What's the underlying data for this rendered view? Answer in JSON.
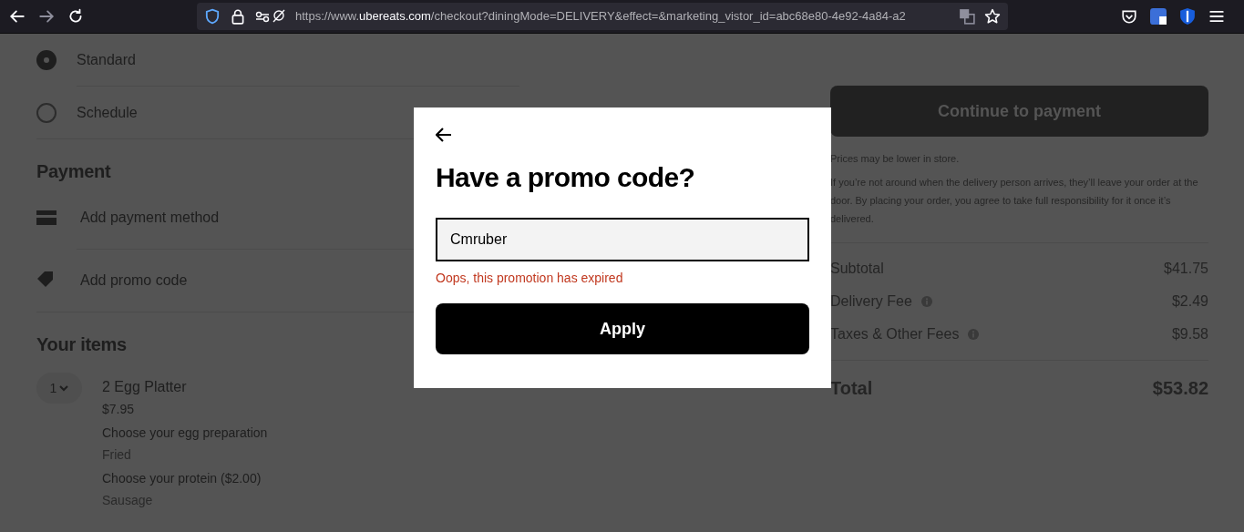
{
  "browser": {
    "url": {
      "prefix": "https://www.",
      "domain": "ubereats.com",
      "path": "/checkout?diningMode=DELIVERY&effect=&marketing_vistor_id=abc68e80-4e92-4a84-a2"
    }
  },
  "delivery_options": [
    {
      "label": "Standard",
      "selected": true
    },
    {
      "label": "Schedule",
      "selected": false
    }
  ],
  "payment": {
    "heading": "Payment",
    "rows": [
      {
        "kind": "card",
        "label": "Add payment method"
      },
      {
        "kind": "tag",
        "label": "Add promo code"
      }
    ]
  },
  "items": {
    "heading": "Your items",
    "list": [
      {
        "quantity": "1",
        "name": "2 Egg Platter",
        "price": "$7.95",
        "options": [
          {
            "question": "Choose your egg preparation",
            "answer": "Fried"
          },
          {
            "question": "Choose your protein ($2.00)",
            "answer": "Sausage"
          }
        ]
      }
    ]
  },
  "summary": {
    "button": "Continue to payment",
    "note": "Prices may be lower in store.",
    "disclaimer": "If you’re not around when the delivery person arrives, they’ll leave your order at the door. By placing your order, you agree to take full responsibility for it once it’s delivered.",
    "lines": [
      {
        "label": "Subtotal",
        "value": "$41.75",
        "info": false
      },
      {
        "label": "Delivery Fee",
        "value": "$2.49",
        "info": true
      },
      {
        "label": "Taxes & Other Fees",
        "value": "$9.58",
        "info": true
      }
    ],
    "total": {
      "label": "Total",
      "value": "$53.82"
    }
  },
  "modal": {
    "title": "Have a promo code?",
    "value": "Cmruber",
    "error": "Oops, this promotion has expired",
    "button": "Apply"
  }
}
